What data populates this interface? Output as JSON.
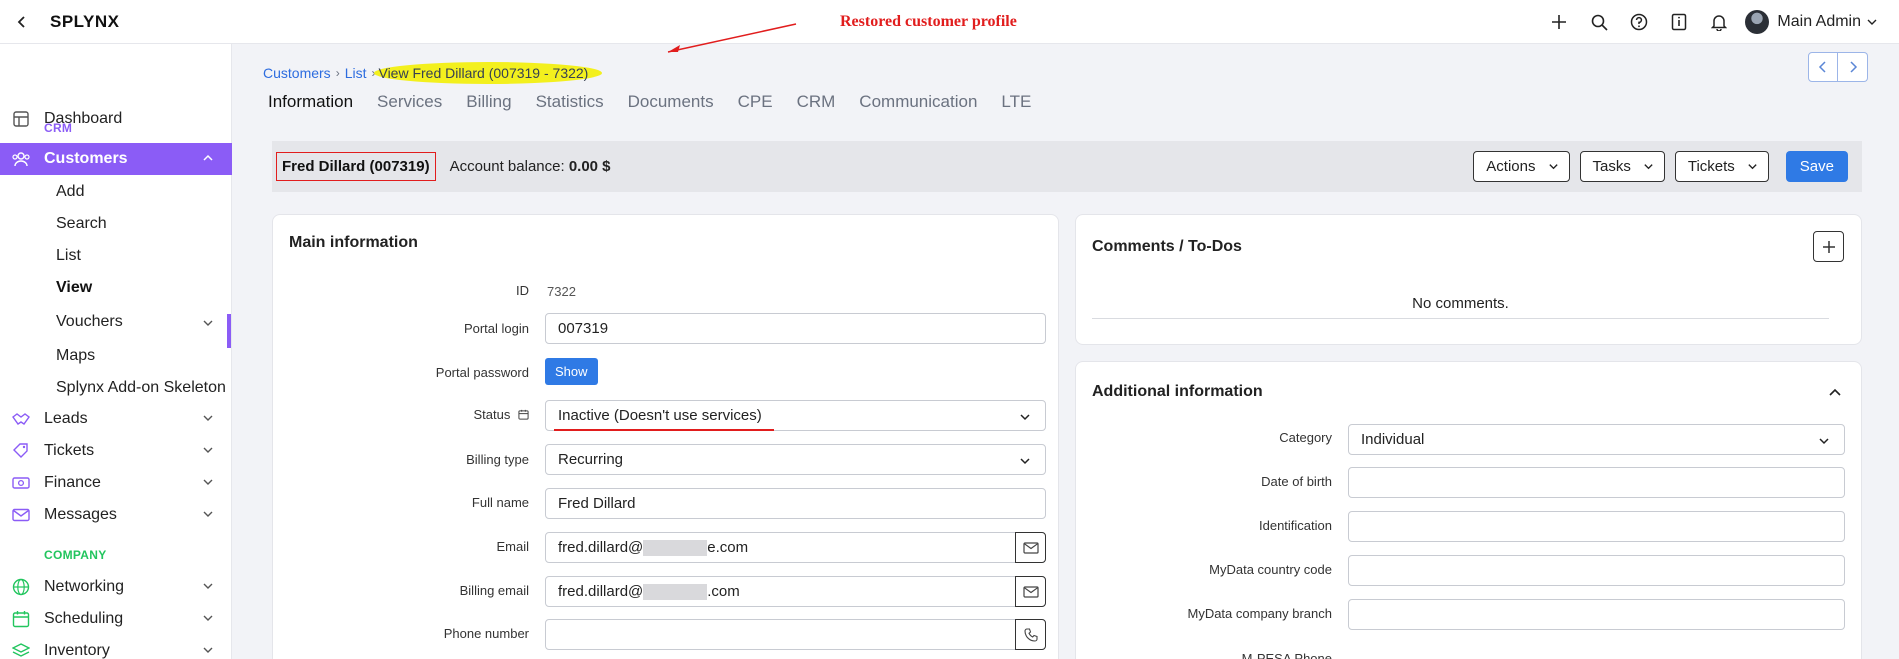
{
  "app": {
    "logo": "SPLYNX",
    "annotation": "Restored customer profile"
  },
  "topbar": {
    "user_name": "Main Admin",
    "icons": [
      "plus-icon",
      "search-icon",
      "help-icon",
      "info-book-icon",
      "bell-icon"
    ]
  },
  "sidebar": {
    "dashboard": "Dashboard",
    "section_crm": "CRM",
    "customers": "Customers",
    "customers_sub": {
      "add": "Add",
      "search": "Search",
      "list": "List",
      "view": "View",
      "vouchers": "Vouchers",
      "maps": "Maps",
      "skeleton": "Splynx Add-on Skeleton"
    },
    "leads": "Leads",
    "tickets": "Tickets",
    "finance": "Finance",
    "messages": "Messages",
    "section_company": "COMPANY",
    "networking": "Networking",
    "scheduling": "Scheduling",
    "inventory": "Inventory",
    "colors": {
      "accent": "#8b5cf6",
      "crm": "#8b5cf6",
      "company": "#22c55e"
    }
  },
  "breadcrumb": {
    "customers": "Customers",
    "list": "List",
    "current": "View Fred Dillard (007319 - 7322)"
  },
  "tabs": [
    "Information",
    "Services",
    "Billing",
    "Statistics",
    "Documents",
    "CPE",
    "CRM",
    "Communication",
    "LTE"
  ],
  "summary": {
    "customer_name": "Fred Dillard (007319)",
    "balance_label": "Account balance:",
    "balance_value": "0.00 $",
    "actions": "Actions",
    "tasks": "Tasks",
    "tickets": "Tickets",
    "save": "Save"
  },
  "main_info": {
    "title": "Main information",
    "id_label": "ID",
    "id_value": "7322",
    "portal_login_label": "Portal login",
    "portal_login_value": "007319",
    "portal_password_label": "Portal password",
    "show_button": "Show",
    "status_label": "Status",
    "status_value": "Inactive (Doesn't use services)",
    "billing_type_label": "Billing type",
    "billing_type_value": "Recurring",
    "full_name_label": "Full name",
    "full_name_value": "Fred Dillard",
    "email_label": "Email",
    "email_prefix": "fred.dillard@",
    "email_suffix": "e.com",
    "billing_email_label": "Billing email",
    "billing_email_prefix": "fred.dillard@",
    "billing_email_suffix": ".com",
    "phone_label": "Phone number",
    "phone_value": ""
  },
  "comments": {
    "title": "Comments / To-Dos",
    "empty": "No comments."
  },
  "additional": {
    "title": "Additional information",
    "category_label": "Category",
    "category_value": "Individual",
    "dob_label": "Date of birth",
    "identification_label": "Identification",
    "mydata_country_label": "MyData country code",
    "mydata_branch_label": "MyData company branch",
    "mpesa_label": "M-PESA Phone"
  }
}
